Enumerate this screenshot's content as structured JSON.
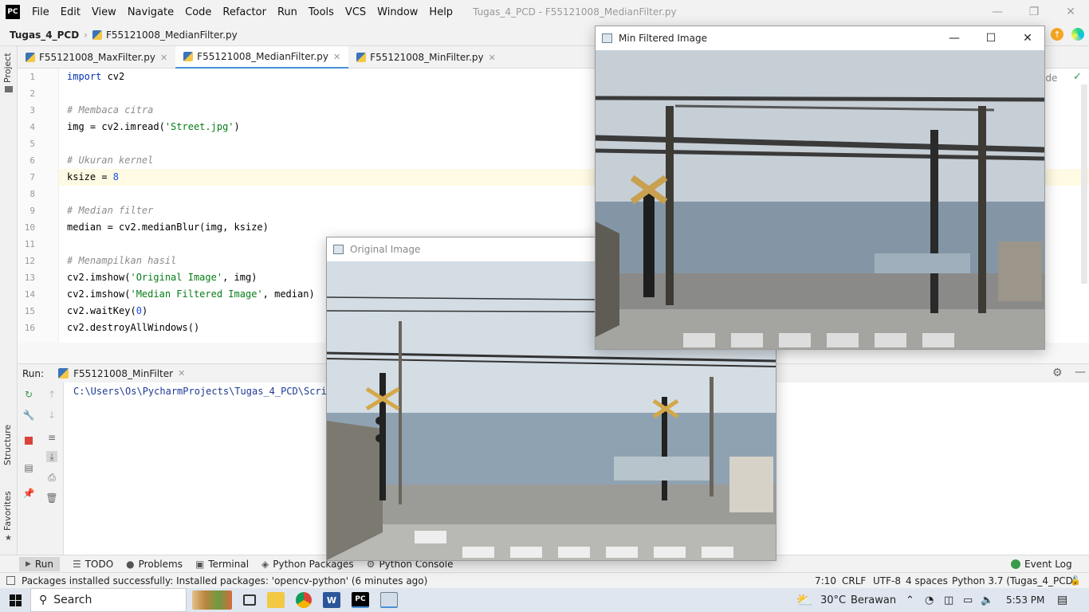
{
  "menu": {
    "items": [
      "File",
      "Edit",
      "View",
      "Navigate",
      "Code",
      "Refactor",
      "Run",
      "Tools",
      "VCS",
      "Window",
      "Help"
    ],
    "window_title": "Tugas_4_PCD - F55121008_MedianFilter.py"
  },
  "nav": {
    "project": "Tugas_4_PCD",
    "file": "F55121008_MedianFilter.py"
  },
  "left_strip": {
    "project": "Project",
    "structure": "Structure",
    "favorites": "Favorites"
  },
  "tabs": [
    {
      "label": "F55121008_MaxFilter.py"
    },
    {
      "label": "F55121008_MedianFilter.py"
    },
    {
      "label": "F55121008_MinFilter.py"
    }
  ],
  "editor": {
    "line_numbers": [
      "1",
      "2",
      "3",
      "4",
      "5",
      "6",
      "7",
      "8",
      "9",
      "10",
      "11",
      "12",
      "13",
      "14",
      "15",
      "16"
    ],
    "lines": {
      "l1_kw": "import",
      "l1_rest": " cv2",
      "l3": "# Membaca citra",
      "l4_a": "img = cv2.imread(",
      "l4_s": "'Street.jpg'",
      "l4_b": ")",
      "l6": "# Ukuran kernel",
      "l7_a": "ksize = ",
      "l7_n": "8",
      "l9": "# Median filter",
      "l10": "median = cv2.medianBlur(img, ksize)",
      "l12": "# Menampilkan hasil",
      "l13_a": "cv2.imshow(",
      "l13_s": "'Original Image'",
      "l13_b": ", img)",
      "l14_a": "cv2.imshow(",
      "l14_s": "'Median Filtered Image'",
      "l14_b": ", median)",
      "l15_a": "cv2.waitKey(",
      "l15_n": "0",
      "l15_b": ")",
      "l16": "cv2.destroyAllWindows()"
    },
    "right_partial": "ode"
  },
  "run": {
    "label": "Run:",
    "config": "F55121008_MinFilter",
    "output": "C:\\Users\\Os\\PycharmProjects\\Tugas_4_PCD\\Script"
  },
  "bottom_tools": [
    {
      "label": "Run"
    },
    {
      "label": "TODO"
    },
    {
      "label": "Problems"
    },
    {
      "label": "Terminal"
    },
    {
      "label": "Python Packages"
    },
    {
      "label": "Python Console"
    }
  ],
  "event_log": "Event Log",
  "status": {
    "message": "Packages installed successfully: Installed packages: 'opencv-python' (6 minutes ago)",
    "position": "7:10",
    "line_sep": "CRLF",
    "encoding": "UTF-8",
    "indent": "4 spaces",
    "interpreter": "Python 3.7 (Tugas_4_PCD)"
  },
  "taskbar": {
    "search": "Search",
    "weather_temp": "30°C",
    "weather_text": "Berawan",
    "time": "5:53 PM"
  },
  "windows": {
    "min_title": "Min Filtered Image",
    "orig_title": "Original Image"
  }
}
